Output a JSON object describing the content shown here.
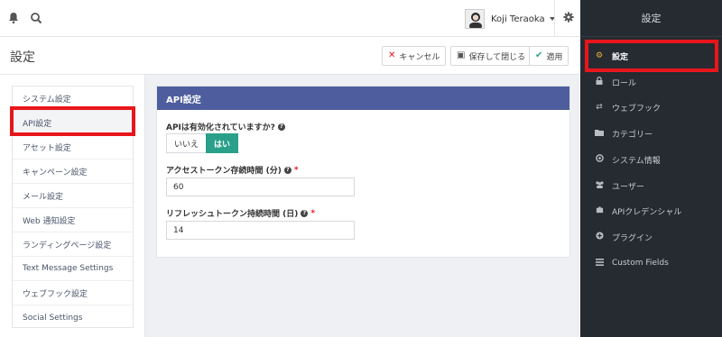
{
  "topbar": {
    "bell_icon": "bell-icon",
    "search_icon": "search-icon",
    "user_name": "Koji Teraoka",
    "settings_icon": "gear-icon"
  },
  "header": {
    "title": "設定",
    "cancel_label": "キャンセル",
    "save_close_label": "保存して閉じる",
    "apply_label": "適用"
  },
  "leftnav": {
    "items": [
      {
        "label": "システム設定"
      },
      {
        "label": "API設定"
      },
      {
        "label": "アセット設定"
      },
      {
        "label": "キャンペーン設定"
      },
      {
        "label": "メール設定"
      },
      {
        "label": "Web 通知設定"
      },
      {
        "label": "ランディングページ設定"
      },
      {
        "label": "Text Message Settings"
      },
      {
        "label": "ウェブフック設定"
      },
      {
        "label": "Social Settings"
      }
    ]
  },
  "panel": {
    "title": "API設定",
    "api_enabled_label": "APIは有効化されていますか?",
    "toggle_no": "いいえ",
    "toggle_yes": "はい",
    "access_token_label": "アクセストークン存続時間 (分)",
    "access_token_value": "60",
    "refresh_token_label": "リフレッシュトークン持続時間 (日)",
    "refresh_token_value": "14",
    "required_mark": "*",
    "help_mark": "?"
  },
  "rightbar": {
    "title": "設定",
    "items": [
      {
        "label": "設定",
        "icon": "cogs-icon"
      },
      {
        "label": "ロール",
        "icon": "lock-icon"
      },
      {
        "label": "ウェブフック",
        "icon": "exchange-icon"
      },
      {
        "label": "カテゴリー",
        "icon": "folder-icon"
      },
      {
        "label": "システム情報",
        "icon": "life-ring-icon"
      },
      {
        "label": "ユーザー",
        "icon": "users-icon"
      },
      {
        "label": "APIクレデンシャル",
        "icon": "puzzle-icon"
      },
      {
        "label": "プラグイン",
        "icon": "plus-circle-icon"
      },
      {
        "label": "Custom Fields",
        "icon": "list-icon"
      }
    ]
  },
  "colors": {
    "highlight": "#e8161b",
    "panel_header": "#4e5d9d",
    "toggle_active": "#2aa08a",
    "sidebar_bg": "#262a31",
    "sidebar_active_icon": "#f0b23c"
  }
}
